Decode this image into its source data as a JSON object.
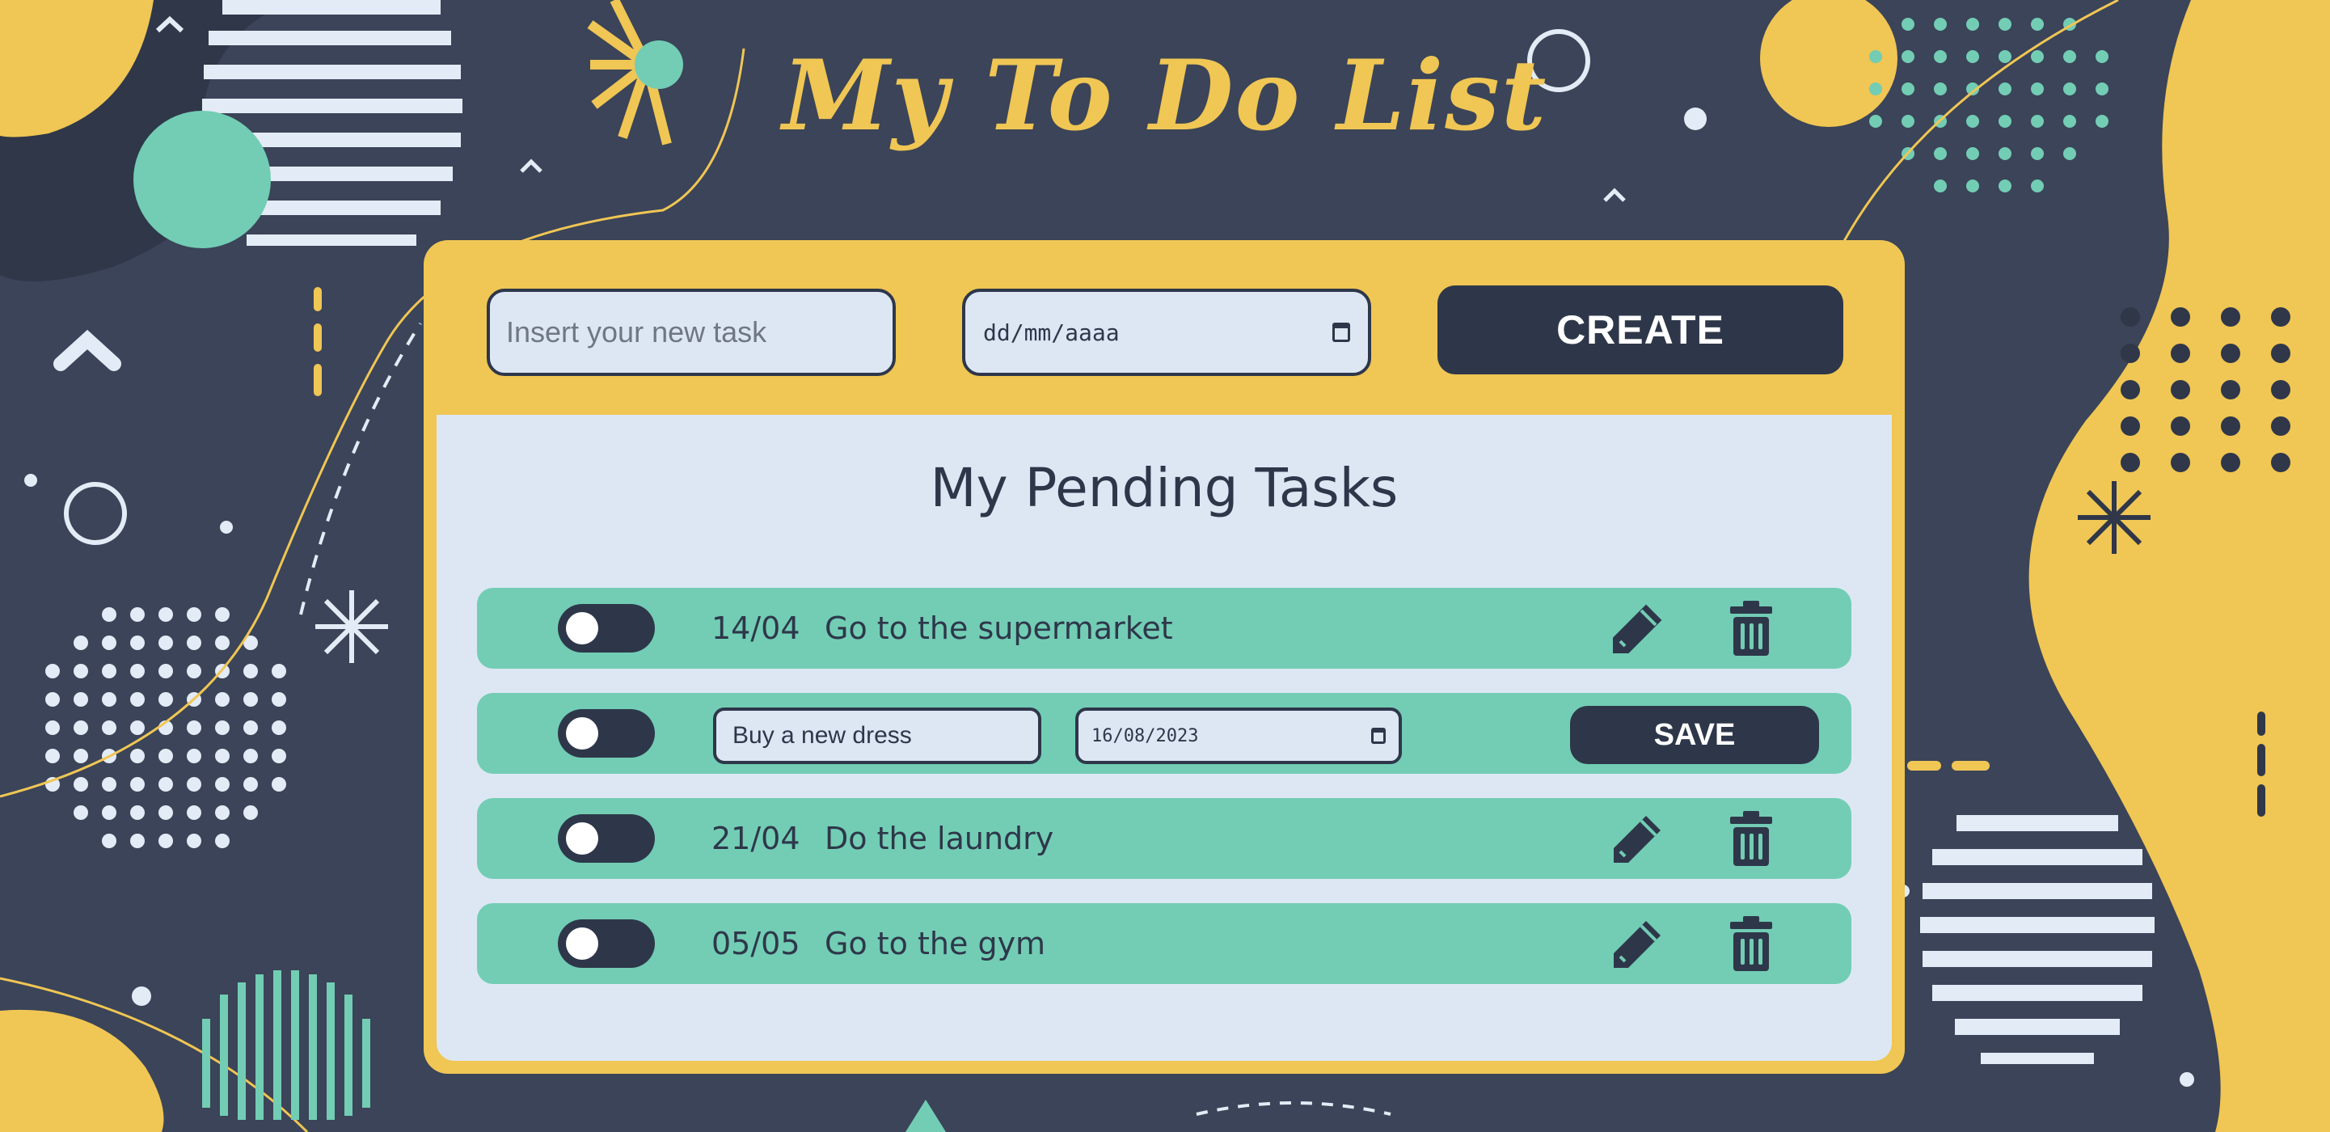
{
  "colors": {
    "background": "#3b4458",
    "accent_yellow": "#f0c654",
    "teal": "#72cdb4",
    "panel": "#dde7f4",
    "navy": "#2e374a",
    "white": "#ffffff"
  },
  "header": {
    "title": "My To Do List"
  },
  "form": {
    "task_placeholder": "Insert your new task",
    "date_placeholder": "dd/mm/aaaa",
    "create_label": "CREATE"
  },
  "panel": {
    "title": "My Pending Tasks"
  },
  "tasks": [
    {
      "date": "14/04",
      "text": "Go to the supermarket",
      "done": false
    },
    {
      "text": "Buy a new dress",
      "date": "16/08/2023",
      "editing": true,
      "save_label": "SAVE",
      "done": false
    },
    {
      "date": "21/04",
      "text": "Do the laundry",
      "done": false
    },
    {
      "date": "05/05",
      "text": "Go to the gym",
      "done": false
    }
  ],
  "icons": {
    "edit": "pencil-icon",
    "delete": "trash-icon",
    "calendar": "calendar-icon"
  }
}
